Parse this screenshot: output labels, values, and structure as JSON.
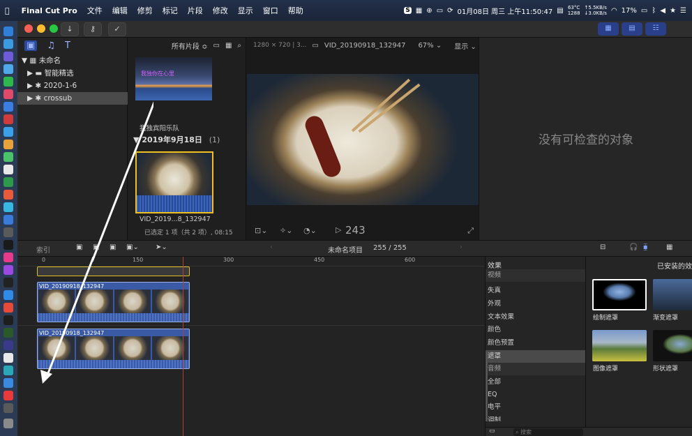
{
  "menubar": {
    "app": "Final Cut Pro",
    "menus": [
      "文件",
      "编辑",
      "修剪",
      "标记",
      "片段",
      "修改",
      "显示",
      "窗口",
      "帮助"
    ],
    "temp": "63°C",
    "fan": "1288",
    "net_up": "↑5.5KB/s",
    "net_down": "↓3.0KB/s",
    "clock": "01月08日 周三 上午11:50:47",
    "battery": "17%"
  },
  "library": {
    "root": "未命名",
    "items": [
      "智能精选",
      "2020-1-6",
      "crossub"
    ]
  },
  "browser": {
    "filter": "所有片段 ≎",
    "clip1_caption": "我独宾阳乐队",
    "clip1_overlay": "我独你在心里",
    "date_group": "2019年9月18日",
    "date_count": "(1)",
    "clip2_caption": "VID_2019...8_132947",
    "selection_status": "已选定 1 项（共 2 项）, 08:15"
  },
  "viewer": {
    "format": "1280 × 720 | 3...",
    "clip_name": "VID_20190918_132947",
    "zoom": "67%",
    "display": "显示",
    "timecode": "243"
  },
  "inspector": {
    "empty_message": "没有可检查的对象"
  },
  "timeline_bar": {
    "index": "索引",
    "project": "未命名项目",
    "duration": "255 / 255"
  },
  "timeline": {
    "ruler": [
      "0",
      "150",
      "300",
      "450",
      "600"
    ],
    "clip_a": "VID_20190918_132947",
    "clip_b": "VID_20190918_132947"
  },
  "effects": {
    "title": "效果",
    "installed": "已安装的效",
    "categories": [
      "视频",
      "失真",
      "外观",
      "文本效果",
      "颜色",
      "颜色预置",
      "遮罩",
      "音频",
      "全部",
      "EQ",
      "电平",
      "调制"
    ],
    "selected": "遮罩",
    "items": [
      "绘制遮罩",
      "渐变遮罩",
      "图像遮罩",
      "形状遮罩"
    ],
    "search_placeholder": "搜索"
  }
}
